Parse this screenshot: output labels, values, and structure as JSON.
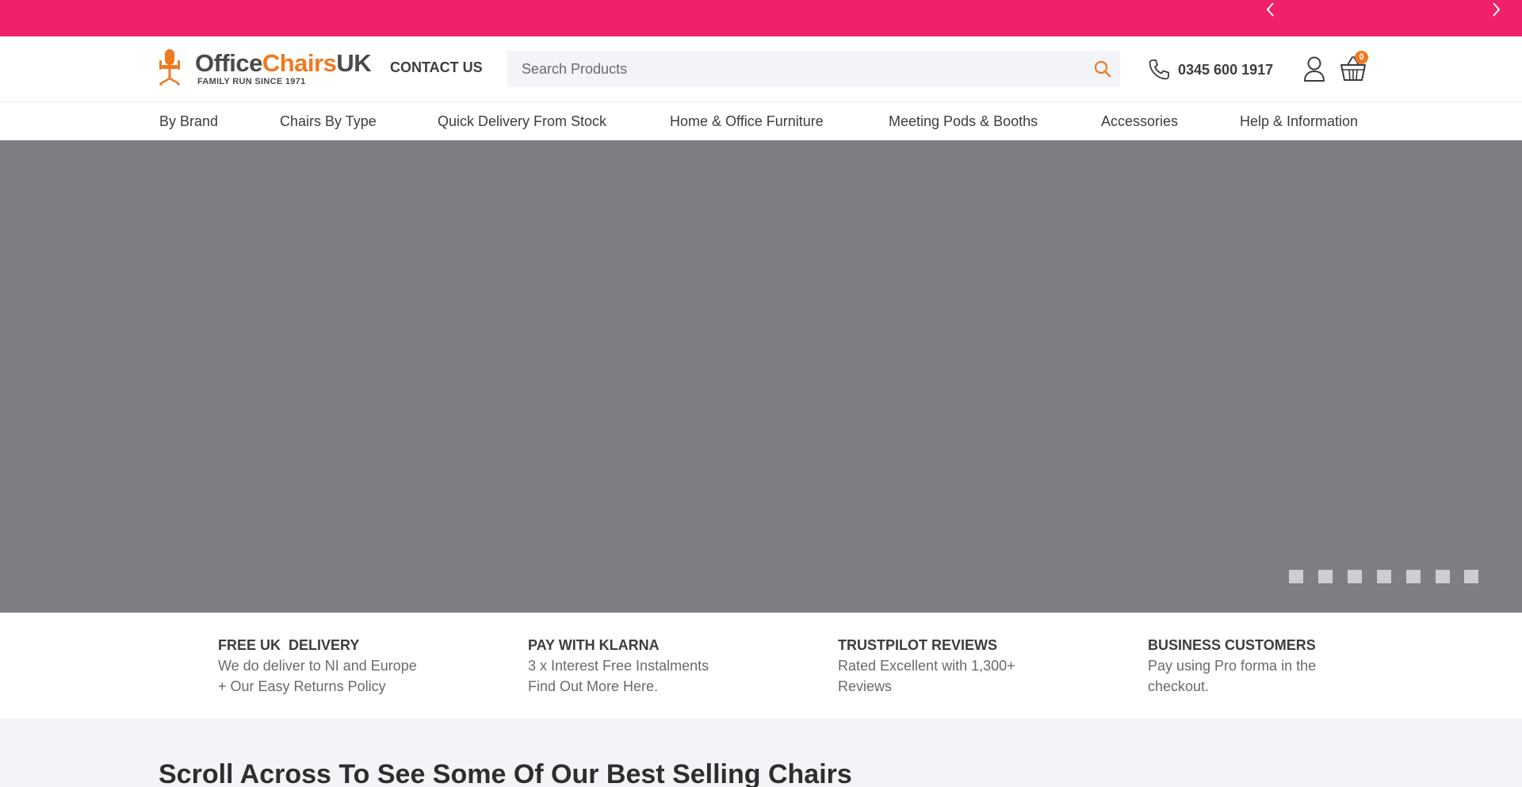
{
  "colors": {
    "topbar": "#f0206a",
    "brand_orange": "#ef7a21",
    "hero_bg": "#7e7f84",
    "section_bg": "#f3f4f8"
  },
  "header": {
    "logo": {
      "word_1": "Office",
      "word_2": "Chairs",
      "word_3": "UK",
      "tagline": "FAMILY RUN SINCE 1971",
      "icon": "office-chair-icon"
    },
    "contact_label": "CONTACT US",
    "search": {
      "placeholder": "Search Products",
      "value": "",
      "icon": "search-icon"
    },
    "phone": {
      "icon": "phone-icon",
      "number": "0345 600 1917"
    },
    "account_icon": "user-icon",
    "basket": {
      "icon": "basket-icon",
      "count": "0"
    }
  },
  "nav": {
    "items": [
      {
        "label": "By Brand"
      },
      {
        "label": "Chairs By Type"
      },
      {
        "label": "Quick Delivery From Stock"
      },
      {
        "label": "Home & Office Furniture"
      },
      {
        "label": "Meeting Pods & Booths"
      },
      {
        "label": "Accessories"
      },
      {
        "label": "Help & Information"
      }
    ]
  },
  "slider": {
    "prev_icon": "chevron-left-icon",
    "next_icon": "chevron-right-icon",
    "slide_count": 7
  },
  "features": [
    {
      "title": "FREE UK  DELIVERY",
      "line1": "We do deliver to NI and Europe",
      "line2": "+ Our Easy Returns Policy"
    },
    {
      "title": "PAY WITH KLARNA",
      "line1": "3 x Interest Free Instalments",
      "line2": "Find Out More Here."
    },
    {
      "title": "TRUSTPILOT REVIEWS",
      "line1": "Rated Excellent with 1,300+",
      "line2": "Reviews"
    },
    {
      "title": "BUSINESS CUSTOMERS",
      "line1": "Pay using Pro forma in the",
      "line2": "checkout."
    }
  ],
  "best_sellers": {
    "title": "Scroll Across To See Some Of Our Best Selling Chairs"
  }
}
